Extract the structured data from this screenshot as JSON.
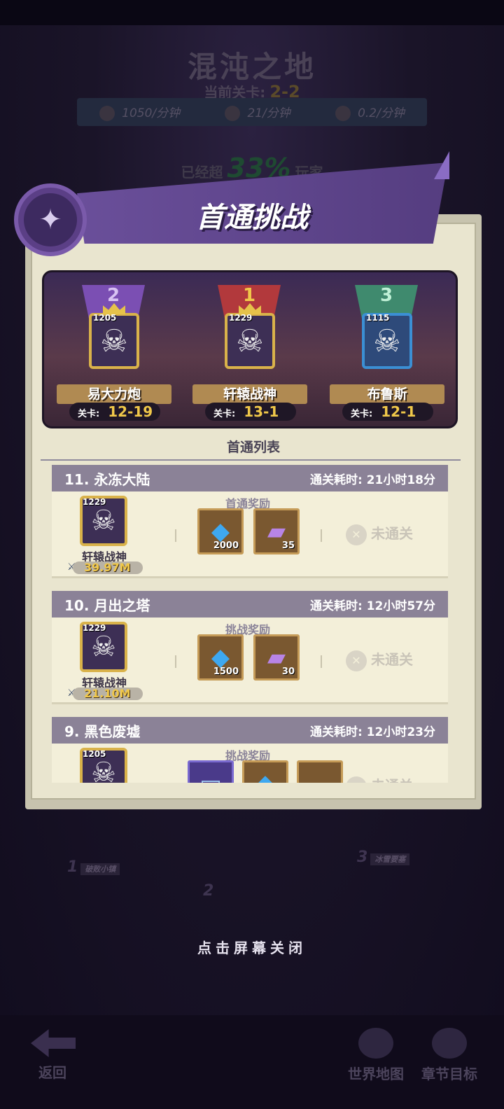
{
  "header": {
    "map_title": "混沌之地",
    "current_stage_label": "当前关卡:",
    "current_stage": "2-2",
    "rates": [
      {
        "icon": "coin-icon",
        "value": "1050/分钟"
      },
      {
        "icon": "potion-icon",
        "value": "21/分钟"
      },
      {
        "icon": "crate-icon",
        "value": "0.2/分钟"
      }
    ],
    "beat_prefix": "已经超",
    "beat_percent": "33%",
    "beat_suffix": "玩家"
  },
  "panel": {
    "title": "首通挑战",
    "list_title": "首通列表"
  },
  "podium": [
    {
      "rank": "2",
      "name": "易大力炮",
      "level": "1205",
      "stage_label": "关卡:",
      "stage": "12-19",
      "flag_color": "#7b4fb3",
      "rank_color": "#b68ae6"
    },
    {
      "rank": "1",
      "name": "轩辕战神",
      "level": "1229",
      "stage_label": "关卡:",
      "stage": "13-1",
      "flag_color": "#b2393c",
      "rank_color": "#f0c84a"
    },
    {
      "rank": "3",
      "name": "布鲁斯",
      "level": "1115",
      "stage_label": "关卡:",
      "stage": "12-1",
      "flag_color": "#3f8a6e",
      "rank_color": "#7fd6a8"
    }
  ],
  "entries": [
    {
      "title": "11. 永冻大陆",
      "clear_time": "通关耗时: 21小时18分",
      "reward_label": "首通奖励",
      "player": "轩辕战神",
      "level": "1229",
      "power": "39.97M",
      "rewards": [
        {
          "icon": "gem-icon",
          "qty": "2000"
        },
        {
          "icon": "book-icon",
          "qty": "35"
        }
      ],
      "status": "未通关"
    },
    {
      "title": "10. 月出之塔",
      "clear_time": "通关耗时: 12小时57分",
      "reward_label": "挑战奖励",
      "player": "轩辕战神",
      "level": "1229",
      "power": "21.10M",
      "rewards": [
        {
          "icon": "gem-icon",
          "qty": "1500"
        },
        {
          "icon": "book-icon",
          "qty": "30"
        }
      ],
      "status": "未通关"
    },
    {
      "title": "9. 黑色废墟",
      "clear_time": "通关耗时: 12小时23分",
      "reward_label": "挑战奖励",
      "player": "",
      "level": "1205",
      "power": "",
      "rewards": [
        {
          "icon": "scroll-icon",
          "qty": ""
        },
        {
          "icon": "gem-icon",
          "qty": ""
        }
      ],
      "status": "未通关"
    }
  ],
  "map": {
    "nodes": [
      {
        "num": "1",
        "label": "破败小镇"
      },
      {
        "num": "2",
        "label": ""
      },
      {
        "num": "3",
        "label": "冰雪要塞"
      }
    ]
  },
  "close_hint": "点击屏幕关闭",
  "nav": {
    "back": "返回",
    "world_map": "世界地图",
    "chapter_goal": "章节目标"
  }
}
